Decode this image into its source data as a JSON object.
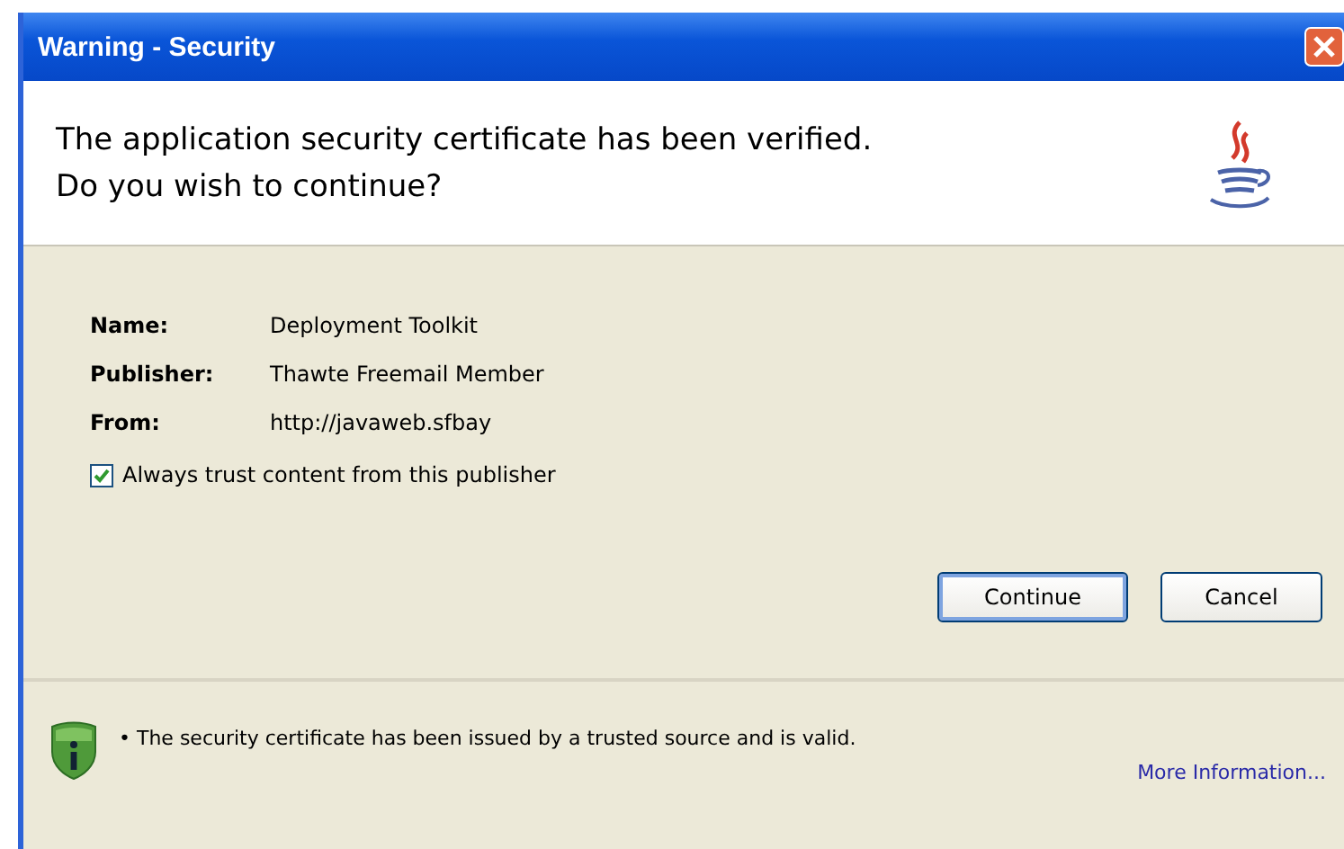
{
  "window": {
    "title": "Warning - Security"
  },
  "header": {
    "message_lines": [
      "The application security certificate has been verified.",
      "Do you wish to continue?"
    ]
  },
  "details": [
    {
      "label": "Name:",
      "value": "Deployment Toolkit"
    },
    {
      "label": "Publisher:",
      "value": "Thawte Freemail Member"
    },
    {
      "label": "From:",
      "value": "http://javaweb.sfbay"
    }
  ],
  "trust_checkbox": {
    "label": "Always trust content from this publisher",
    "checked": true
  },
  "buttons": [
    {
      "label": "Continue",
      "selected": true
    },
    {
      "label": "Cancel",
      "selected": false
    }
  ],
  "footer": {
    "note": "• The security certificate has been issued by a trusted source and is valid.",
    "link": "More Information..."
  }
}
